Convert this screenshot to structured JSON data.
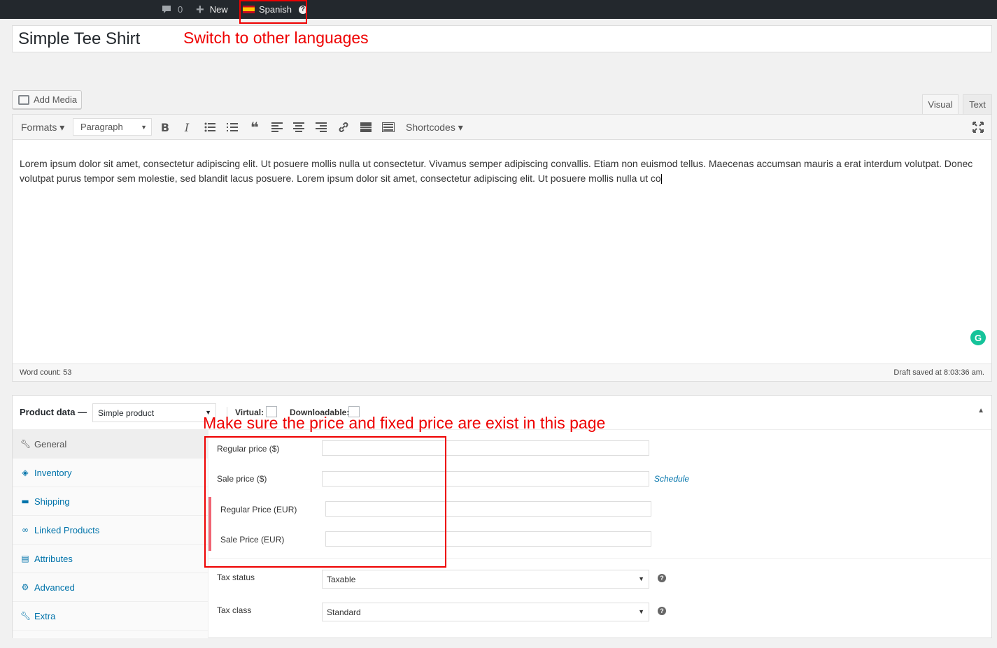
{
  "admin_bar": {
    "comments_count": "0",
    "new_label": "New",
    "language_label": "Spanish",
    "help_glyph": "?",
    "icons": {
      "comments": "comment-bubble-icon",
      "new": "plus-icon",
      "language": "spain-flag-icon"
    }
  },
  "annotations": {
    "language_note": "Switch to other languages",
    "price_note": "Make sure the price and fixed price are exist in this page",
    "highlight_color": "#ee0000"
  },
  "post": {
    "title": "Simple Tee Shirt"
  },
  "editor": {
    "add_media_label": "Add Media",
    "tabs": {
      "visual": "Visual",
      "text": "Text",
      "active": "visual"
    },
    "formats_label": "Formats ▾",
    "paragraph_select": "Paragraph",
    "shortcodes_label": "Shortcodes ▾",
    "toolbar_icons": [
      "bold-icon",
      "italic-icon",
      "bullet-list-icon",
      "numbered-list-icon",
      "blockquote-icon",
      "align-left-icon",
      "align-center-icon",
      "align-right-icon",
      "link-icon",
      "read-more-icon",
      "toolbar-toggle-icon",
      "fullscreen-icon"
    ],
    "content": "Lorem ipsum dolor sit amet, consectetur adipiscing elit. Ut posuere mollis nulla ut consectetur. Vivamus semper adipiscing convallis. Etiam non euismod tellus. Maecenas accumsan mauris a erat interdum volutpat. Donec volutpat purus tempor sem molestie, sed blandit lacus posuere. Lorem ipsum dolor sit amet, consectetur adipiscing elit. Ut posuere mollis nulla ut co",
    "word_count": "Word count: 53",
    "draft_saved": "Draft saved at 8:03:36 am.",
    "grammarly_glyph": "G"
  },
  "product_data": {
    "heading": "Product data —",
    "product_type": "Simple product",
    "virtual_label": "Virtual:",
    "downloadable_label": "Downloadable:",
    "virtual_checked": false,
    "downloadable_checked": false,
    "collapse_glyph": "▲",
    "tabs": [
      {
        "label": "General",
        "icon": "wrench-icon",
        "active": true
      },
      {
        "label": "Inventory",
        "icon": "tag-icon",
        "active": false
      },
      {
        "label": "Shipping",
        "icon": "truck-icon",
        "active": false
      },
      {
        "label": "Linked Products",
        "icon": "link-icon",
        "active": false
      },
      {
        "label": "Attributes",
        "icon": "list-icon",
        "active": false
      },
      {
        "label": "Advanced",
        "icon": "gear-icon",
        "active": false
      },
      {
        "label": "Extra",
        "icon": "wrench-icon",
        "active": false
      }
    ],
    "fields": {
      "regular_price_label": "Regular price ($)",
      "regular_price_value": "",
      "sale_price_label": "Sale price ($)",
      "sale_price_value": "",
      "schedule_link": "Schedule",
      "regular_price_eur_label": "Regular Price (EUR)",
      "regular_price_eur_value": "",
      "sale_price_eur_label": "Sale Price (EUR)",
      "sale_price_eur_value": "",
      "tax_status_label": "Tax status",
      "tax_status_value": "Taxable",
      "tax_class_label": "Tax class",
      "tax_class_value": "Standard"
    }
  }
}
